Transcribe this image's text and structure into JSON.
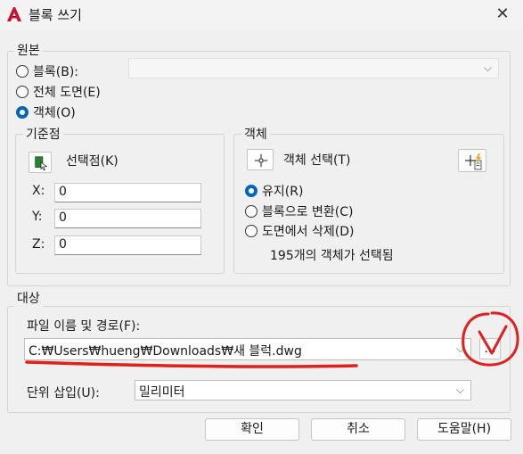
{
  "window": {
    "title": "블록 쓰기",
    "close_glyph": "✕"
  },
  "source": {
    "label": "원본",
    "options": [
      {
        "label": "블록(B):",
        "selected": false
      },
      {
        "label": "전체 도면(E)",
        "selected": false
      },
      {
        "label": "객체(O)",
        "selected": true
      }
    ]
  },
  "base_point": {
    "label": "기준점",
    "pick_label": "선택점(K)",
    "x_label": "X:",
    "x_value": "0",
    "y_label": "Y:",
    "y_value": "0",
    "z_label": "Z:",
    "z_value": "0"
  },
  "objects": {
    "label": "객체",
    "select_label": "객체 선택(T)",
    "options": [
      {
        "label": "유지(R)",
        "selected": true
      },
      {
        "label": "블록으로 변환(C)",
        "selected": false
      },
      {
        "label": "도면에서 삭제(D)",
        "selected": false
      }
    ],
    "status": "195개의 객체가 선택됨"
  },
  "destination": {
    "label": "대상",
    "path_label": "파일 이름 및 경로(F):",
    "path_value": "C:₩Users₩hueng₩Downloads₩새 블럭.dwg",
    "browse_label": "...",
    "units_label": "단위 삽입(U):",
    "units_value": "밀리미터"
  },
  "buttons": {
    "ok": "확인",
    "cancel": "취소",
    "help": "도움말(H)"
  },
  "colors": {
    "accent": "#0067c0",
    "annotation": "#e0201c",
    "app_red": "#c8102e"
  }
}
